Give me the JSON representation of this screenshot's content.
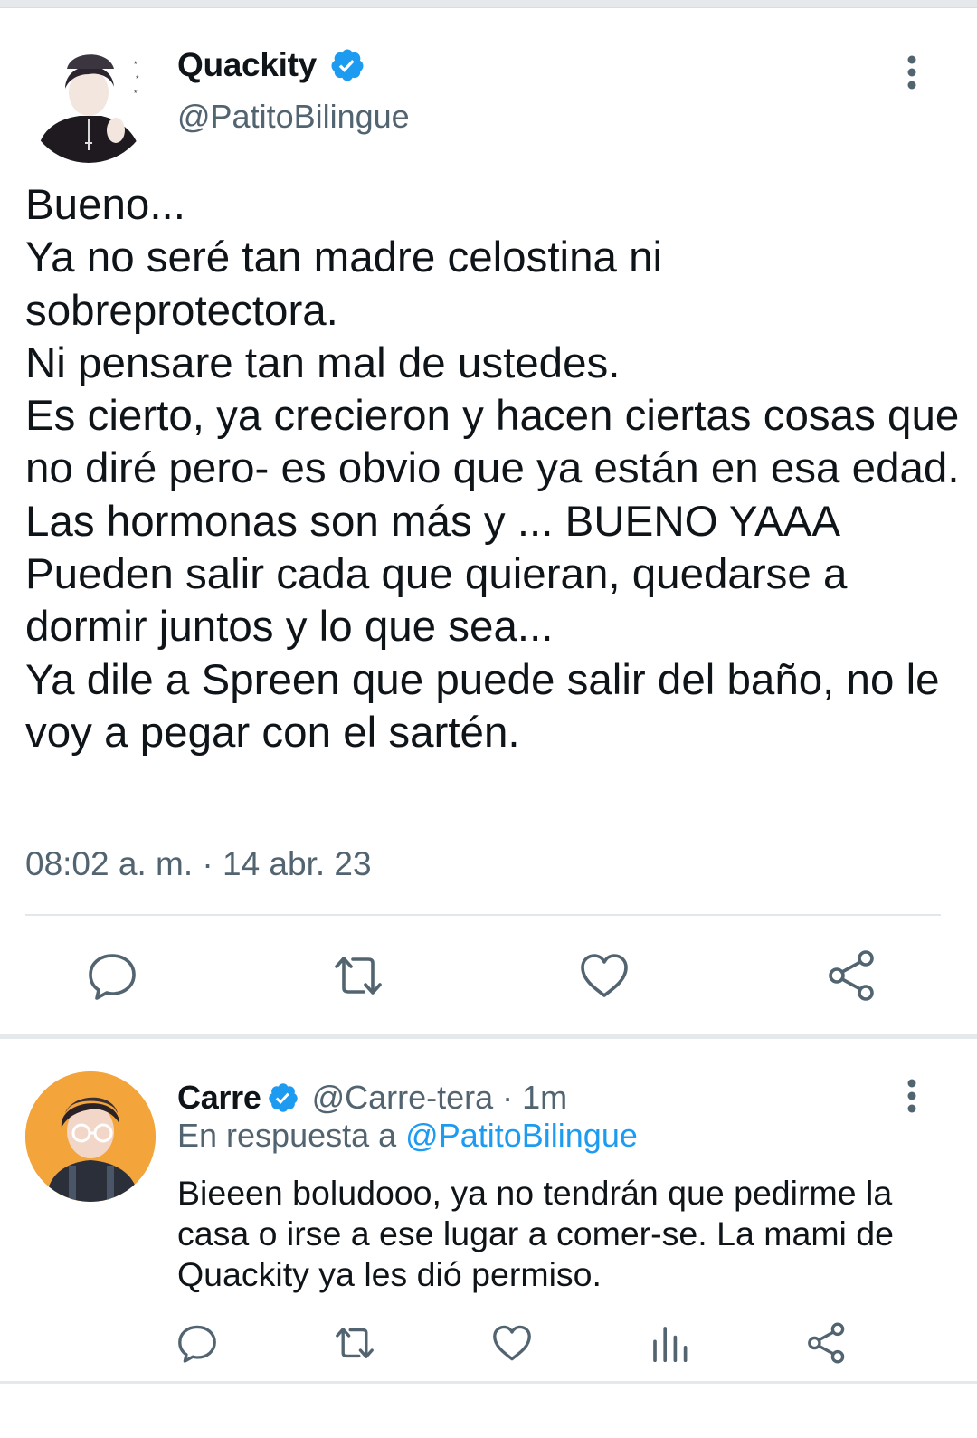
{
  "main_tweet": {
    "display_name": "Quackity",
    "handle": "@PatitoBilingue",
    "text": "Bueno...\nYa no seré tan madre celostina ni sobreprotectora.\nNi pensare tan mal de ustedes.\nEs cierto, ya crecieron y hacen ciertas cosas que no diré pero- es obvio que ya están en esa edad.\nLas hormonas son más y ... BUENO YAAA\nPueden salir cada que quieran, quedarse a dormir juntos y lo que sea...\nYa dile a Spreen que puede salir del baño, no le voy a pegar con el sartén.",
    "timestamp": "08:02 a. m. · 14 abr. 23"
  },
  "reply": {
    "display_name": "Carre",
    "meta": "@Carre-tera · 1m",
    "replying_prefix": "En respuesta a ",
    "replying_mention": "@PatitoBilingue",
    "text": "Bieeen boludooo, ya no tendrán que pedirme la casa o irse a ese lugar a comer-se. La mami de Quackity ya les dió permiso."
  },
  "icons": {
    "verified": "verified-badge-icon",
    "more": "more-vertical-icon",
    "reply": "reply-icon",
    "retweet": "retweet-icon",
    "like": "heart-icon",
    "share": "share-icon",
    "analytics": "analytics-icon"
  },
  "colors": {
    "verified_blue": "#1d9bf0",
    "secondary_text": "#536471",
    "mention": "#1d9bf0",
    "reply_avatar_bg": "#f3a43a"
  }
}
